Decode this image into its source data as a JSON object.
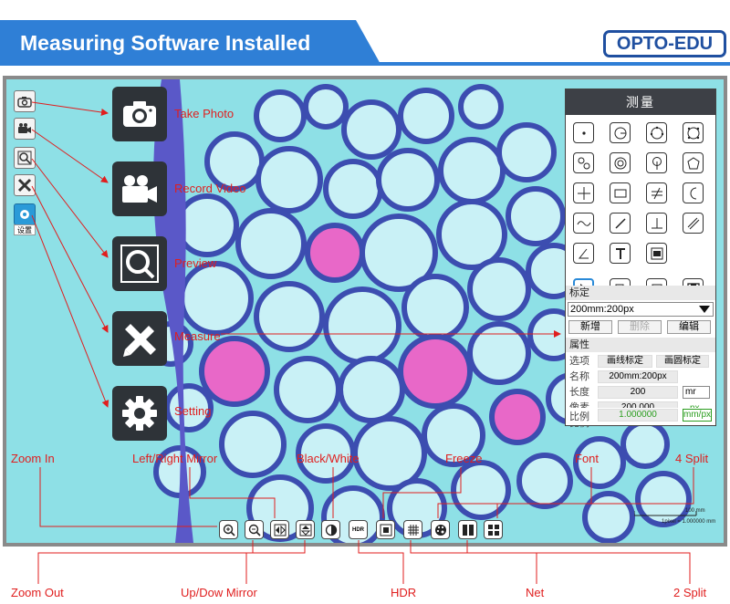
{
  "header": {
    "title": "Measuring Software Installed",
    "brand": "OPTO-EDU"
  },
  "sidebar": {
    "setting_caption": "设置",
    "items": [
      {
        "icon": "camera-icon"
      },
      {
        "icon": "video-camera-icon"
      },
      {
        "icon": "magnifier-icon"
      },
      {
        "icon": "ruler-pencil-icon"
      },
      {
        "icon": "gear-icon"
      }
    ]
  },
  "big_icons": [
    {
      "icon": "camera-icon",
      "label": "Take Photo"
    },
    {
      "icon": "video-camera-icon",
      "label": "Record Video"
    },
    {
      "icon": "magnifier-icon",
      "label": "Preview"
    },
    {
      "icon": "ruler-pencil-icon",
      "label": "Measure"
    },
    {
      "icon": "gear-icon",
      "label": "Setting"
    }
  ],
  "panel": {
    "title": "测量",
    "calibration_section": "标定",
    "calibration_value": "200mm:200px",
    "buttons": {
      "add": "新增",
      "delete": "删除",
      "edit": "编辑"
    },
    "properties_section": "属性",
    "rows": {
      "option_label": "选项",
      "option_a": "画线标定",
      "option_b": "画圆标定",
      "name_label": "名称",
      "name_value": "200mm:200px",
      "length_label": "长度",
      "length_value": "200",
      "length_unit": "mr",
      "pixel_label": "像素",
      "pixel_value": "200.000",
      "pixel_unit": "px",
      "ratio_label": "比例",
      "ratio_value": "1.000000",
      "ratio_unit": "mm/px"
    }
  },
  "scale_bar": {
    "length_label": "100 mm",
    "pixel_label": "1pixel = 1.000000 mm"
  },
  "toolbar_labels": {
    "zoom_in": "Zoom In",
    "lr_mirror": "Left/Right Mirror",
    "black_white": "Black/White",
    "freeze": "Freeze",
    "font": "Font",
    "split4": "4 Split",
    "zoom_out": "Zoom Out",
    "ud_mirror": "Up/Dow Mirror",
    "hdr": "HDR",
    "net": "Net",
    "split2": "2 Split"
  },
  "hdr_button": "HDR",
  "colors": {
    "banner": "#2f7fd6",
    "brand": "#1f4fa0",
    "label_red": "#e01e1e",
    "cell_wall": "#3c4db0",
    "cell_fill": "#c9f1f6",
    "pink": "#e868c8"
  }
}
